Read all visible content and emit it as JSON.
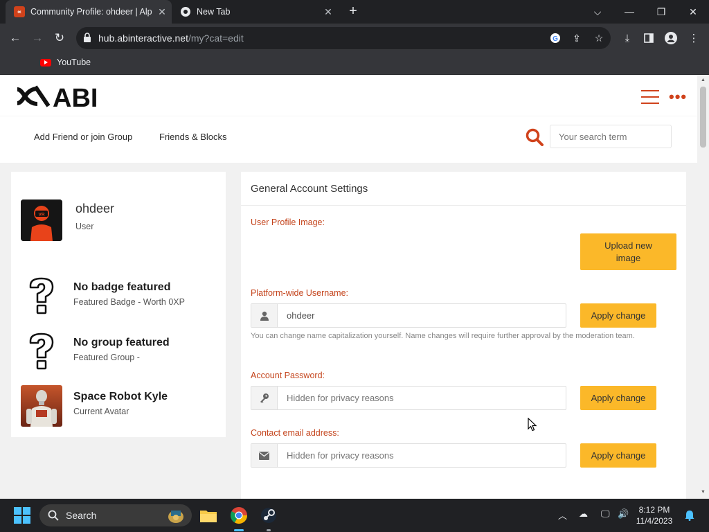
{
  "browser": {
    "tabs": [
      {
        "title": "Community Profile: ohdeer | Alp",
        "favicon": "abi-logo-icon",
        "active": true
      },
      {
        "title": "New Tab",
        "favicon": "chrome-icon",
        "active": false
      }
    ],
    "url_domain": "hub.abinteractive.net",
    "url_path": "/my?cat=edit",
    "bookmarks": [
      {
        "label": "YouTube",
        "icon": "youtube-icon"
      }
    ]
  },
  "site": {
    "logo_text": "ABI",
    "nav": {
      "add_friend": "Add Friend or join Group",
      "friends_blocks": "Friends & Blocks"
    },
    "search_placeholder": "Your search term",
    "accent_color": "#d0421b",
    "button_color": "#fbb829"
  },
  "profile": {
    "username": "ohdeer",
    "role": "User",
    "badge": {
      "title": "No badge featured",
      "subtitle": "Featured Badge - Worth 0XP"
    },
    "group": {
      "title": "No group featured",
      "subtitle": "Featured Group -"
    },
    "avatar": {
      "title": "Space Robot Kyle",
      "subtitle": "Current Avatar"
    }
  },
  "settings": {
    "heading": "General Account Settings",
    "profile_image_label": "User Profile Image:",
    "upload_button": "Upload new image",
    "username_label": "Platform-wide Username:",
    "username_value": "ohdeer",
    "apply_label": "Apply change",
    "username_help": "You can change name capitalization yourself. Name changes will require further approval by the moderation team.",
    "password_label": "Account Password:",
    "password_placeholder": "Hidden for privacy reasons",
    "email_label": "Contact email address:",
    "email_placeholder": "Hidden for privacy reasons"
  },
  "taskbar": {
    "search_label": "Search",
    "time": "8:12 PM",
    "date": "11/4/2023"
  }
}
